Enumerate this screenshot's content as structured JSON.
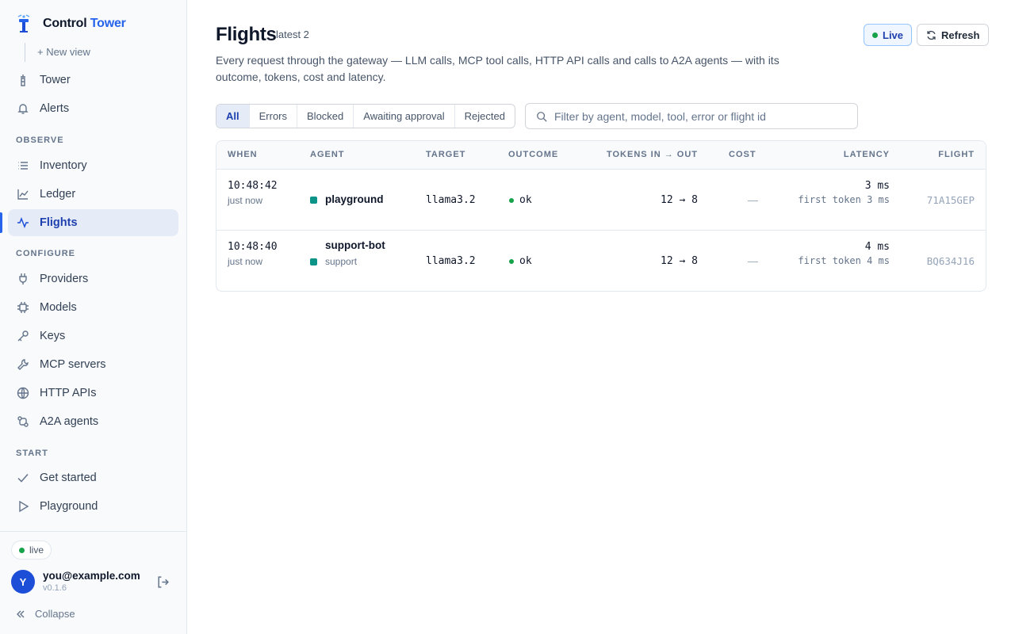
{
  "brand": {
    "name_part1": "Control",
    "name_part2": "Tower"
  },
  "sidebar": {
    "new_view": "+ New view",
    "top_items": [
      {
        "label": "Tower",
        "icon": "tower-icon"
      },
      {
        "label": "Alerts",
        "icon": "bell-icon"
      }
    ],
    "sections": [
      {
        "label": "OBSERVE",
        "items": [
          {
            "label": "Inventory",
            "icon": "list-icon"
          },
          {
            "label": "Ledger",
            "icon": "line-chart-icon"
          },
          {
            "label": "Flights",
            "icon": "activity-icon",
            "active": true
          }
        ]
      },
      {
        "label": "CONFIGURE",
        "items": [
          {
            "label": "Providers",
            "icon": "plug-icon"
          },
          {
            "label": "Models",
            "icon": "cpu-icon"
          },
          {
            "label": "Keys",
            "icon": "key-icon"
          },
          {
            "label": "MCP servers",
            "icon": "wrench-icon"
          },
          {
            "label": "HTTP APIs",
            "icon": "globe-icon"
          },
          {
            "label": "A2A agents",
            "icon": "agents-icon"
          }
        ]
      },
      {
        "label": "START",
        "items": [
          {
            "label": "Get started",
            "icon": "check-icon"
          },
          {
            "label": "Playground",
            "icon": "play-icon"
          }
        ]
      }
    ],
    "footer": {
      "status": "live",
      "avatar_initial": "Y",
      "email": "you@example.com",
      "version": "v0.1.6",
      "collapse": "Collapse"
    }
  },
  "page": {
    "title": "Flights",
    "subtitle": "latest 2",
    "description": "Every request through the gateway — LLM calls, MCP tool calls, HTTP API calls and calls to A2A agents — with its outcome, tokens, cost and latency.",
    "live_button": "Live",
    "refresh_button": "Refresh"
  },
  "filters": {
    "tabs": [
      "All",
      "Errors",
      "Blocked",
      "Awaiting approval",
      "Rejected"
    ],
    "active": "All",
    "search_placeholder": "Filter by agent, model, tool, error or flight id"
  },
  "table": {
    "columns": [
      "WHEN",
      "AGENT",
      "TARGET",
      "OUTCOME",
      "TOKENS IN → OUT",
      "COST",
      "LATENCY",
      "FLIGHT"
    ],
    "rows": [
      {
        "time": "10:48:42",
        "ago": "just now",
        "agent": "playground",
        "agent_sub": "",
        "target": "llama3.2",
        "outcome": "ok",
        "tokens": "12 → 8",
        "cost": "—",
        "latency": "3 ms",
        "first_token": "first token 3 ms",
        "flight": "71A15GEP"
      },
      {
        "time": "10:48:40",
        "ago": "just now",
        "agent": "support-bot",
        "agent_sub": "support",
        "target": "llama3.2",
        "outcome": "ok",
        "tokens": "12 → 8",
        "cost": "—",
        "latency": "4 ms",
        "first_token": "first token 4 ms",
        "flight": "BQ634J16"
      }
    ]
  },
  "colors": {
    "accent": "#2563eb",
    "active_nav_bg": "#e6ecf7",
    "status_ok": "#16a34a",
    "agent_tag": "#0d9488"
  }
}
